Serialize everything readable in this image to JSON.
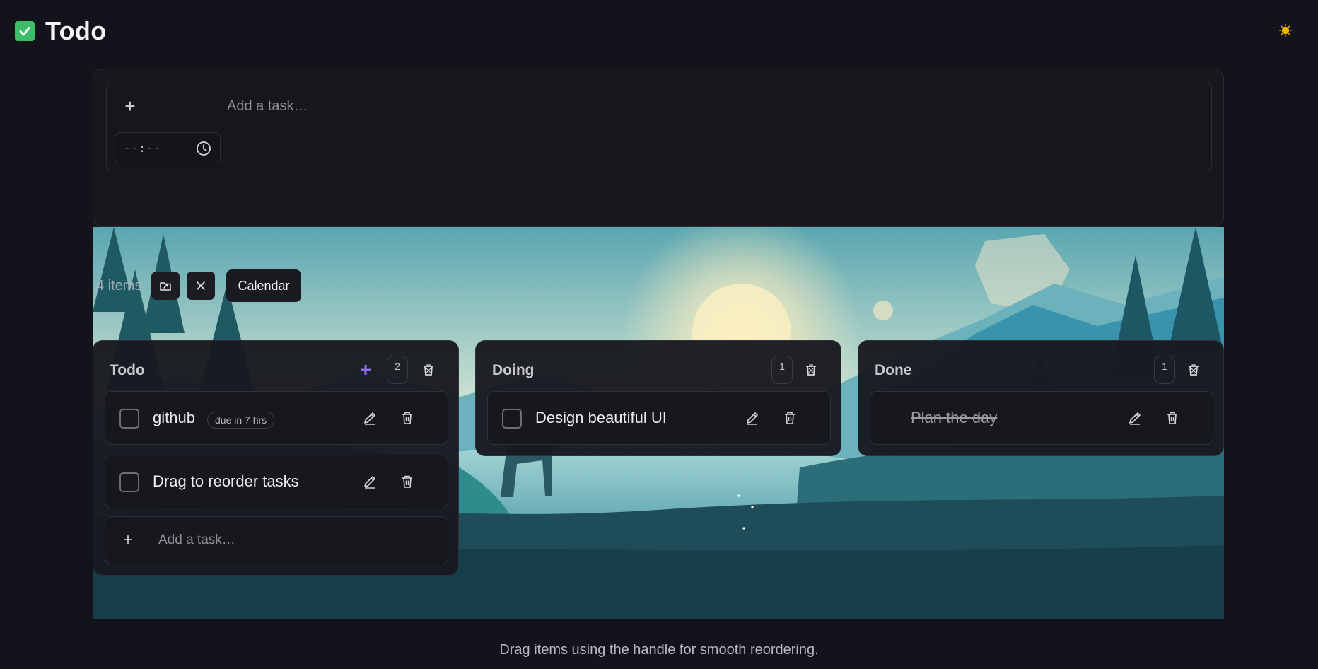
{
  "app": {
    "title": "Todo"
  },
  "composer": {
    "placeholder": "Add a task…",
    "time_value": "--:--"
  },
  "toolbar": {
    "items_count": "4 items",
    "calendar_label": "Calendar"
  },
  "columns": [
    {
      "title": "Todo",
      "count": "2",
      "tasks": [
        {
          "text": "github",
          "due": "due in 7 hrs"
        },
        {
          "text": "Drag to reorder tasks"
        }
      ],
      "add_placeholder": "Add a task…"
    },
    {
      "title": "Doing",
      "count": "1",
      "tasks": [
        {
          "text": "Design beautiful UI"
        }
      ]
    },
    {
      "title": "Done",
      "count": "1",
      "tasks": [
        {
          "text": "Plan the day",
          "completed": true
        }
      ]
    }
  ],
  "footer": {
    "hint": "Drag items using the handle for smooth reordering."
  },
  "colors": {
    "background": "#13141b",
    "accent_purple": "#8b6be0",
    "check_green": "#3dbd6a",
    "sun_yellow": "#f4b400"
  }
}
